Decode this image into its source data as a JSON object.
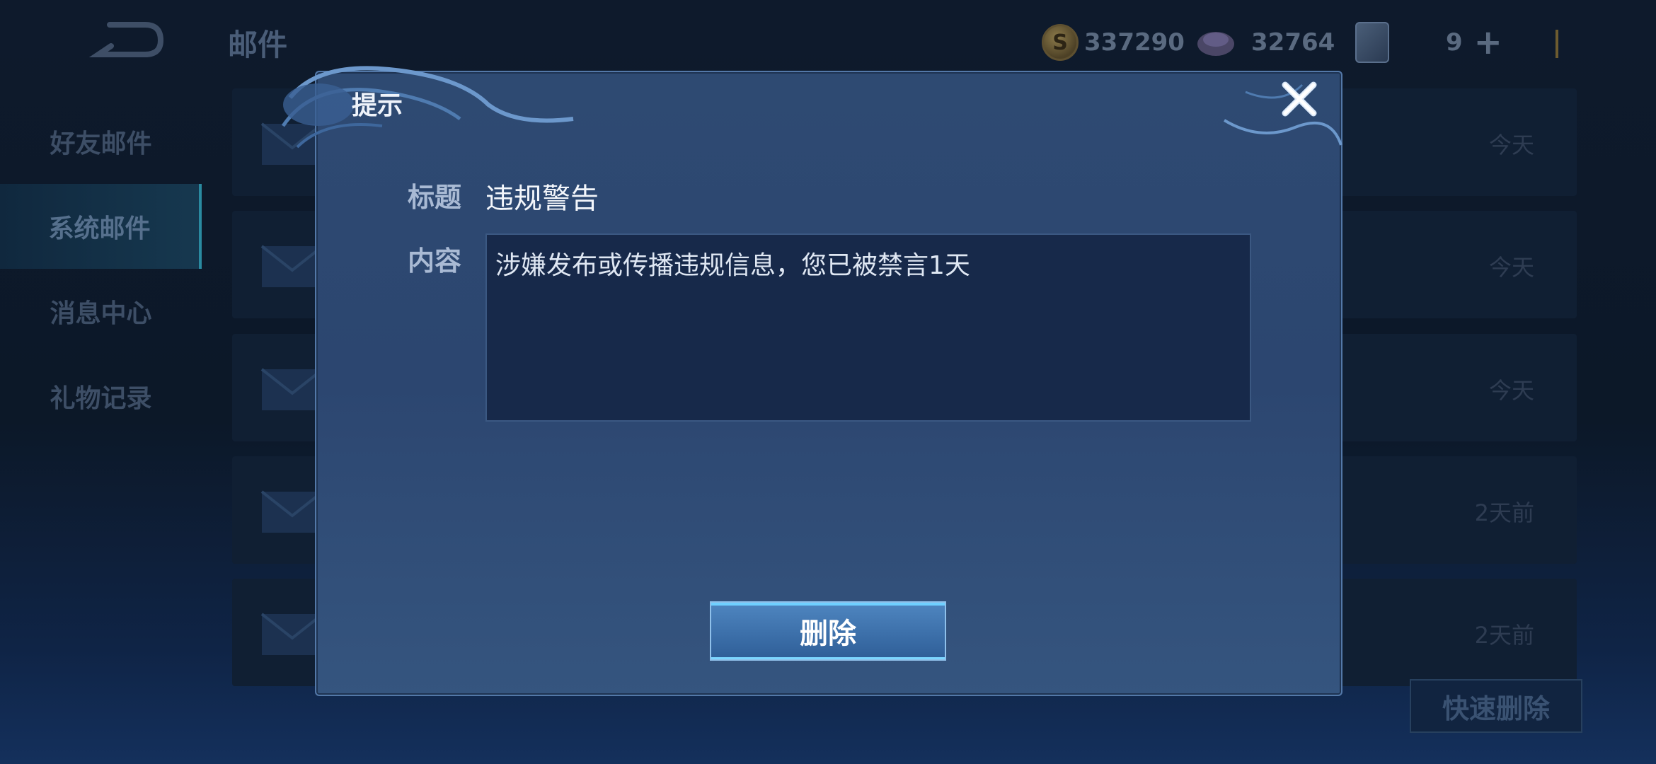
{
  "header": {
    "title": "邮件",
    "gold": "337290",
    "diamonds": "32764",
    "cards": "9"
  },
  "sidebar": {
    "items": [
      {
        "label": "好友邮件"
      },
      {
        "label": "系统邮件"
      },
      {
        "label": "消息中心"
      },
      {
        "label": "礼物记录"
      }
    ]
  },
  "mail_list": {
    "rows": [
      {
        "date": "今天"
      },
      {
        "date": "今天"
      },
      {
        "date": "今天"
      },
      {
        "date": "2天前"
      },
      {
        "date": "2天前"
      }
    ],
    "quick_delete_label": "快速删除"
  },
  "dialog": {
    "title": "提示",
    "subject_label": "标题",
    "subject": "违规警告",
    "content_label": "内容",
    "content": "涉嫌发布或传播违规信息，您已被禁言1天",
    "delete_label": "删除"
  }
}
